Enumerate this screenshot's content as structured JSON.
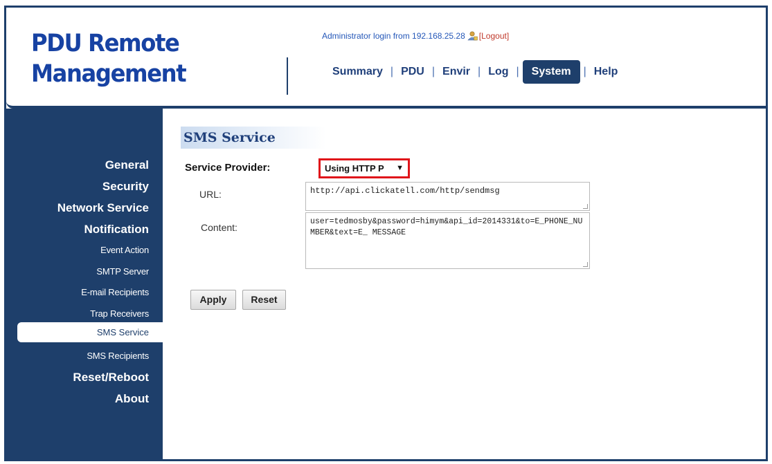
{
  "app": {
    "title_line1": "PDU Remote",
    "title_line2": "Management"
  },
  "header": {
    "login_text": "Administrator login from 192.168.25.28",
    "logout_label": "[Logout]",
    "nav": [
      "Summary",
      "PDU",
      "Envir",
      "Log",
      "System",
      "Help"
    ],
    "active_nav": "System"
  },
  "sidebar": {
    "items": [
      {
        "label": "General",
        "level": "main"
      },
      {
        "label": "Security",
        "level": "main"
      },
      {
        "label": "Network Service",
        "level": "main"
      },
      {
        "label": "Notification",
        "level": "main"
      },
      {
        "label": "Event Action",
        "level": "sub"
      },
      {
        "label": "SMTP Server",
        "level": "sub"
      },
      {
        "label": "E-mail Recipients",
        "level": "sub"
      },
      {
        "label": "Trap Receivers",
        "level": "sub"
      },
      {
        "label": "SMS Service",
        "level": "sub",
        "active": true
      },
      {
        "label": "SMS Recipients",
        "level": "sub"
      },
      {
        "label": "Reset/Reboot",
        "level": "main"
      },
      {
        "label": "About",
        "level": "main"
      }
    ]
  },
  "main": {
    "section_title": "SMS Service",
    "service_provider_label": "Service Provider:",
    "service_provider_value": "Using HTTP P",
    "url_label": "URL:",
    "url_value": "http://api.clickatell.com/http/sendmsg",
    "content_label": "Content:",
    "content_value": "user=tedmosby&password=himym&api_id=2014331&to=E_PHONE_NUMBER&text=E_ MESSAGE",
    "apply_label": "Apply",
    "reset_label": "Reset"
  },
  "colors": {
    "navy": "#1e3f6b",
    "logo_blue": "#1742a3",
    "highlight_red": "#e0141a"
  },
  "icons": {
    "login_user": "user-icon",
    "dropdown": "chevron-down-icon"
  }
}
